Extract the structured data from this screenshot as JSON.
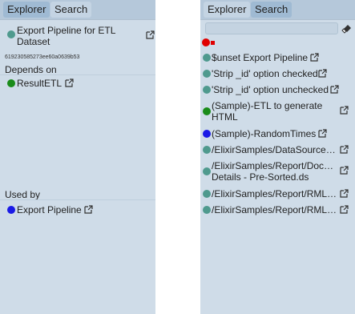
{
  "left": {
    "tabs": [
      "Explorer",
      "Search"
    ],
    "title": "Export Pipeline for ETL Dataset",
    "id": "619230585273ee60a0639b53",
    "depends_on_label": "Depends on",
    "depends_on": [
      {
        "label": "ResultETL",
        "color": "#1a8c1a"
      }
    ],
    "used_by_label": "Used by",
    "used_by": [
      {
        "label": "Export Pipeline",
        "color": "#1a1ae6"
      }
    ]
  },
  "right": {
    "tabs": [
      "Explorer",
      "Search"
    ],
    "search_placeholder": "",
    "results": [
      {
        "label": "$unset Export Pipeline",
        "color": "#4f9a8e"
      },
      {
        "label": "'Strip _id' option checked",
        "color": "#4f9a8e"
      },
      {
        "label": "'Strip _id' option unchecked",
        "color": "#4f9a8e"
      },
      {
        "label": "(Sample)-ETL to generate",
        "label2": "HTML",
        "color": "#1a8c1a"
      },
      {
        "label": "(Sample)-RandomTimes",
        "color": "#1a1ae6"
      },
      {
        "label": "/ElixirSamples/DataSource…",
        "color": "#4f9a8e"
      },
      {
        "label": "/ElixirSamples/Report/Doc…",
        "label2": "Details - Pre-Sorted.ds",
        "color": "#4f9a8e"
      },
      {
        "label": "/ElixirSamples/Report/RML…",
        "color": "#4f9a8e"
      },
      {
        "label": "/ElixirSamples/Report/RML…",
        "color": "#4f9a8e"
      }
    ]
  },
  "icons": {
    "external": "external-link-icon",
    "eraser": "eraser-icon"
  }
}
